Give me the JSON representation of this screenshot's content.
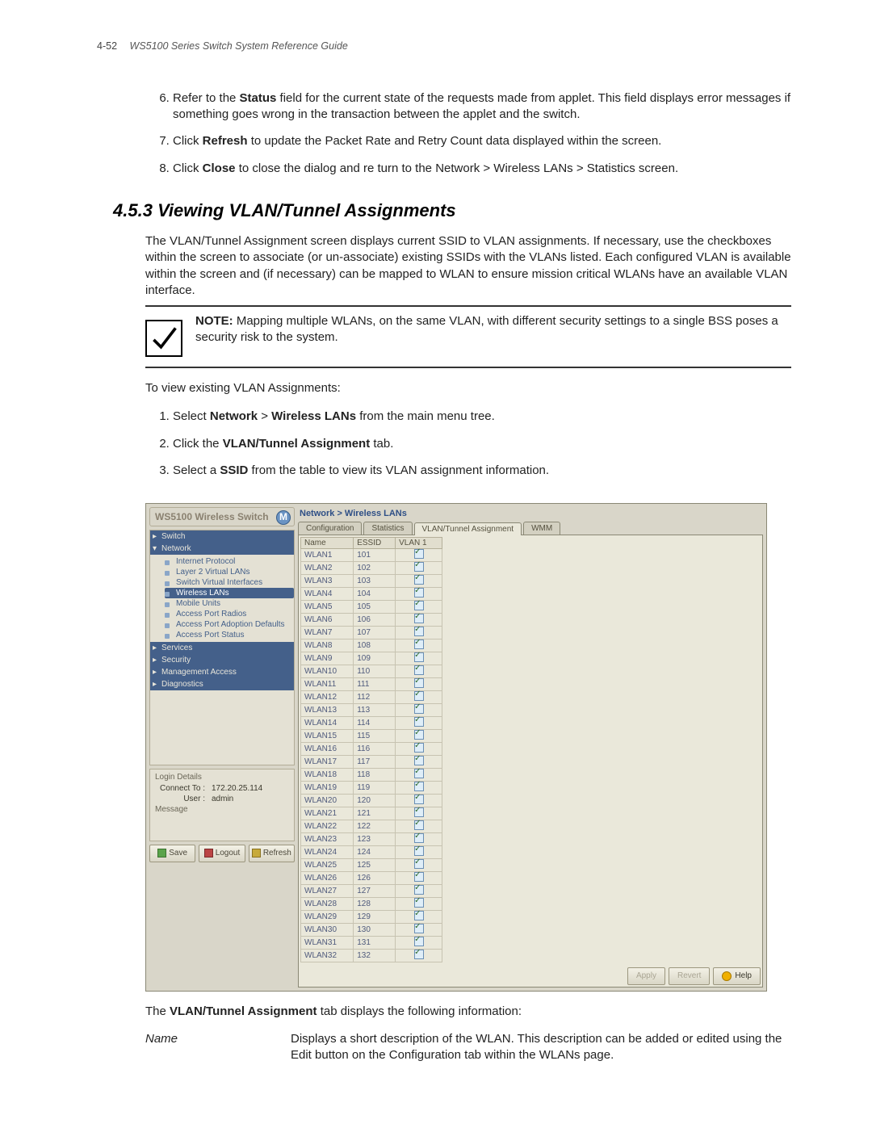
{
  "page": {
    "number": "4-52",
    "doc_title": "WS5100 Series Switch System Reference Guide"
  },
  "steps_top": [
    {
      "n": 6,
      "pre": "Refer to the ",
      "b": "Status",
      "post": " field for the current state of the requests made from applet. This field displays error messages if something goes wrong in the transaction between the applet and the switch."
    },
    {
      "n": 7,
      "pre": "Click ",
      "b": "Refresh",
      "post": " to update the Packet Rate and Retry Count data displayed within the screen."
    },
    {
      "n": 8,
      "pre": "Click ",
      "b": "Close",
      "post": " to close the dialog and re turn to the Network > Wireless LANs > Statistics screen."
    }
  ],
  "section": {
    "num": "4.5.3",
    "title": "Viewing VLAN/Tunnel Assignments"
  },
  "intro": "The VLAN/Tunnel Assignment screen displays current SSID to VLAN assignments. If necessary, use the checkboxes within the screen to associate (or un-associate) existing SSIDs with the VLANs listed. Each configured VLAN is available within the screen and (if necessary) can be mapped to WLAN to ensure mission critical WLANs have an available VLAN interface.",
  "note": {
    "label": "NOTE:",
    "text": " Mapping multiple WLANs, on the same VLAN, with different security settings to a single BSS poses a security risk to the system."
  },
  "lead2": "To view existing VLAN Assignments:",
  "steps2": [
    {
      "n": 1,
      "parts": [
        {
          "t": "Select "
        },
        {
          "b": true,
          "t": "Network"
        },
        {
          "t": " > "
        },
        {
          "b": true,
          "t": "Wireless LANs"
        },
        {
          "t": " from the main menu tree."
        }
      ]
    },
    {
      "n": 2,
      "parts": [
        {
          "t": "Click the "
        },
        {
          "b": true,
          "t": "VLAN/Tunnel Assignment"
        },
        {
          "t": " tab."
        }
      ]
    },
    {
      "n": 3,
      "parts": [
        {
          "t": "Select a "
        },
        {
          "b": true,
          "t": "SSID"
        },
        {
          "t": " from the table to view its VLAN assignment information."
        }
      ]
    }
  ],
  "ui": {
    "product": "WS5100 Wireless Switch",
    "logo": "M",
    "nav": {
      "switch": "Switch",
      "network": "Network",
      "children": [
        "Internet Protocol",
        "Layer 2 Virtual LANs",
        "Switch Virtual Interfaces",
        "Wireless LANs",
        "Mobile Units",
        "Access Port Radios",
        "Access Port Adoption Defaults",
        "Access Port Status"
      ],
      "selected_index": 3,
      "services": "Services",
      "security": "Security",
      "mgmt": "Management Access",
      "diag": "Diagnostics"
    },
    "login": {
      "legend": "Login Details",
      "connect_label": "Connect To :",
      "connect": "172.20.25.114",
      "user_label": "User :",
      "user": "admin",
      "msg_label": "Message"
    },
    "bottom": {
      "save": "Save",
      "logout": "Logout",
      "refresh": "Refresh"
    },
    "crumb": "Network > Wireless LANs",
    "tabs": [
      "Configuration",
      "Statistics",
      "VLAN/Tunnel Assignment",
      "WMM"
    ],
    "active_tab": 2,
    "grid": {
      "headers": [
        "Name",
        "ESSID",
        "VLAN 1"
      ],
      "rows": [
        [
          "WLAN1",
          "101",
          true
        ],
        [
          "WLAN2",
          "102",
          true
        ],
        [
          "WLAN3",
          "103",
          true
        ],
        [
          "WLAN4",
          "104",
          true
        ],
        [
          "WLAN5",
          "105",
          true
        ],
        [
          "WLAN6",
          "106",
          true
        ],
        [
          "WLAN7",
          "107",
          true
        ],
        [
          "WLAN8",
          "108",
          true
        ],
        [
          "WLAN9",
          "109",
          true
        ],
        [
          "WLAN10",
          "110",
          true
        ],
        [
          "WLAN11",
          "111",
          true
        ],
        [
          "WLAN12",
          "112",
          true
        ],
        [
          "WLAN13",
          "113",
          true
        ],
        [
          "WLAN14",
          "114",
          true
        ],
        [
          "WLAN15",
          "115",
          true
        ],
        [
          "WLAN16",
          "116",
          true
        ],
        [
          "WLAN17",
          "117",
          true
        ],
        [
          "WLAN18",
          "118",
          true
        ],
        [
          "WLAN19",
          "119",
          true
        ],
        [
          "WLAN20",
          "120",
          true
        ],
        [
          "WLAN21",
          "121",
          true
        ],
        [
          "WLAN22",
          "122",
          true
        ],
        [
          "WLAN23",
          "123",
          true
        ],
        [
          "WLAN24",
          "124",
          true
        ],
        [
          "WLAN25",
          "125",
          true
        ],
        [
          "WLAN26",
          "126",
          true
        ],
        [
          "WLAN27",
          "127",
          true
        ],
        [
          "WLAN28",
          "128",
          true
        ],
        [
          "WLAN29",
          "129",
          true
        ],
        [
          "WLAN30",
          "130",
          true
        ],
        [
          "WLAN31",
          "131",
          true
        ],
        [
          "WLAN32",
          "132",
          true
        ]
      ]
    },
    "footer": {
      "apply": "Apply",
      "revert": "Revert",
      "help": "Help"
    }
  },
  "post_text": {
    "pre": "The ",
    "b": "VLAN/Tunnel Assignment",
    "post": " tab displays the following information:"
  },
  "desc": {
    "k": "Name",
    "v": "Displays a short description of the WLAN. This description can be added or edited using the Edit button on the Configuration tab within the WLANs page."
  }
}
